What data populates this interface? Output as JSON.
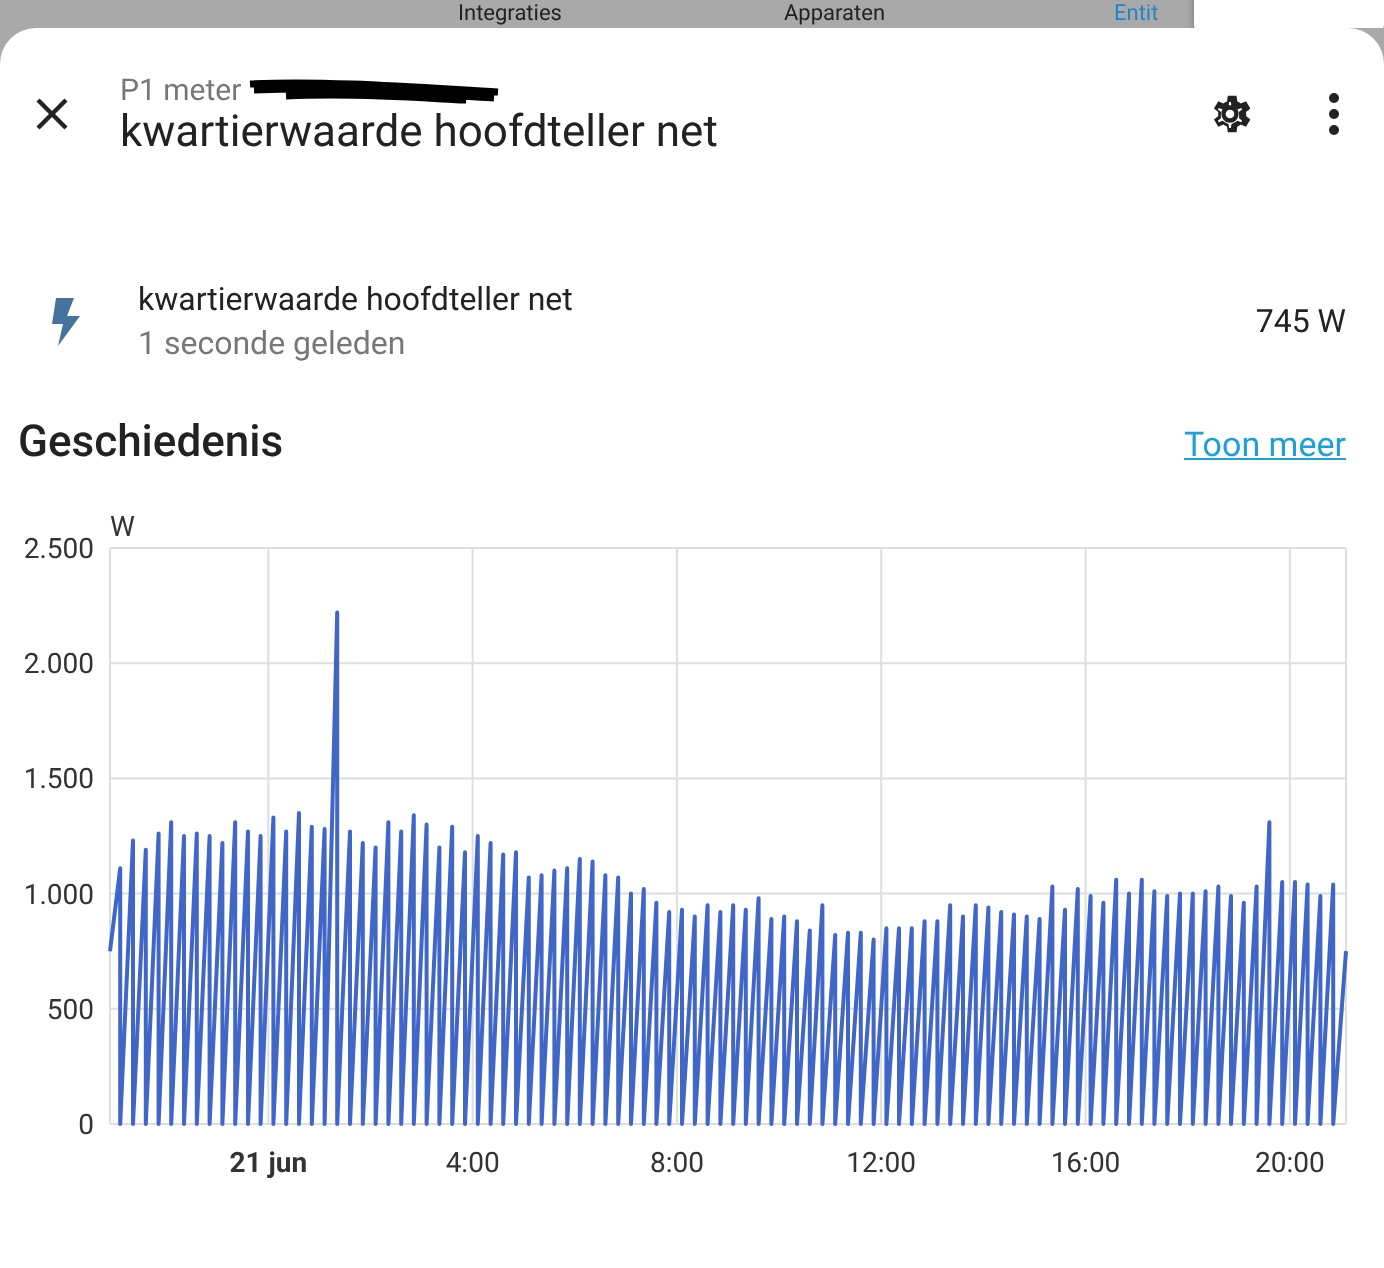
{
  "background_tabs": [
    {
      "label": "Integraties",
      "selected": false
    },
    {
      "label": "Apparaten",
      "selected": false
    },
    {
      "label": "Entit",
      "selected": true
    }
  ],
  "dialog": {
    "subtitle": "P1 meter",
    "title": "kwartierwaarde hoofdteller net"
  },
  "entity": {
    "name": "kwartierwaarde hoofdteller net",
    "last_changed": "1 seconde geleden",
    "state": "745 W"
  },
  "history": {
    "title": "Geschiedenis",
    "more_link": "Toon meer",
    "chart_data": {
      "type": "line",
      "ylabel": "W",
      "grid": true,
      "xlim": [
        -3.1,
        21.1
      ],
      "ylim": [
        0,
        2500
      ],
      "xticks": [
        {
          "value": 0,
          "label": "21 jun"
        },
        {
          "value": 4,
          "label": "4:00"
        },
        {
          "value": 8,
          "label": "8:00"
        },
        {
          "value": 12,
          "label": "12:00"
        },
        {
          "value": 16,
          "label": "16:00"
        },
        {
          "value": 20,
          "label": "20:00"
        }
      ],
      "yticks": [
        {
          "value": 0,
          "label": "0"
        },
        {
          "value": 500,
          "label": "500"
        },
        {
          "value": 1000,
          "label": "1.000"
        },
        {
          "value": 1500,
          "label": "1.500"
        },
        {
          "value": 2000,
          "label": "2.000"
        },
        {
          "value": 2500,
          "label": "2.500"
        }
      ],
      "x": [
        -3.1,
        -2.9,
        -2.9,
        -2.65,
        -2.65,
        -2.4,
        -2.4,
        -2.15,
        -2.15,
        -1.9,
        -1.9,
        -1.65,
        -1.65,
        -1.4,
        -1.4,
        -1.15,
        -1.15,
        -0.9,
        -0.9,
        -0.65,
        -0.65,
        -0.4,
        -0.4,
        -0.15,
        -0.15,
        0.1,
        0.1,
        0.35,
        0.35,
        0.6,
        0.6,
        0.85,
        0.85,
        1.1,
        1.1,
        1.35,
        1.35,
        1.6,
        1.6,
        1.85,
        1.85,
        2.1,
        2.1,
        2.35,
        2.35,
        2.6,
        2.6,
        2.85,
        2.85,
        3.1,
        3.1,
        3.35,
        3.35,
        3.6,
        3.6,
        3.85,
        3.85,
        4.1,
        4.1,
        4.35,
        4.35,
        4.6,
        4.6,
        4.85,
        4.85,
        5.1,
        5.1,
        5.35,
        5.35,
        5.6,
        5.6,
        5.85,
        5.85,
        6.1,
        6.1,
        6.35,
        6.35,
        6.6,
        6.6,
        6.85,
        6.85,
        7.1,
        7.1,
        7.35,
        7.35,
        7.6,
        7.6,
        7.85,
        7.85,
        8.1,
        8.1,
        8.35,
        8.35,
        8.6,
        8.6,
        8.85,
        8.85,
        9.1,
        9.1,
        9.35,
        9.35,
        9.6,
        9.6,
        9.85,
        9.85,
        10.1,
        10.1,
        10.35,
        10.35,
        10.6,
        10.6,
        10.85,
        10.85,
        11.1,
        11.1,
        11.35,
        11.35,
        11.6,
        11.6,
        11.85,
        11.85,
        12.1,
        12.1,
        12.35,
        12.35,
        12.6,
        12.6,
        12.85,
        12.85,
        13.1,
        13.1,
        13.35,
        13.35,
        13.6,
        13.6,
        13.85,
        13.85,
        14.1,
        14.1,
        14.35,
        14.35,
        14.6,
        14.6,
        14.85,
        14.85,
        15.1,
        15.1,
        15.35,
        15.35,
        15.6,
        15.6,
        15.85,
        15.85,
        16.1,
        16.1,
        16.35,
        16.35,
        16.6,
        16.6,
        16.85,
        16.85,
        17.1,
        17.1,
        17.35,
        17.35,
        17.6,
        17.6,
        17.85,
        17.85,
        18.1,
        18.1,
        18.35,
        18.35,
        18.6,
        18.6,
        18.85,
        18.85,
        19.1,
        19.1,
        19.35,
        19.35,
        19.6,
        19.6,
        19.85,
        19.85,
        20.1,
        20.1,
        20.35,
        20.35,
        20.6,
        20.6,
        20.85,
        20.85,
        21.1
      ],
      "series": [
        {
          "color": "#4066c8",
          "values": [
            750,
            1110,
            0,
            1230,
            0,
            1190,
            0,
            1260,
            0,
            1310,
            0,
            1250,
            0,
            1260,
            0,
            1250,
            0,
            1220,
            0,
            1310,
            0,
            1270,
            0,
            1250,
            0,
            1330,
            0,
            1270,
            0,
            1350,
            0,
            1290,
            0,
            1280,
            0,
            2220,
            0,
            1270,
            0,
            1220,
            0,
            1200,
            0,
            1310,
            0,
            1270,
            0,
            1340,
            0,
            1300,
            0,
            1200,
            0,
            1290,
            0,
            1180,
            0,
            1250,
            0,
            1220,
            0,
            1170,
            0,
            1180,
            0,
            1070,
            0,
            1080,
            0,
            1100,
            0,
            1110,
            0,
            1150,
            0,
            1140,
            0,
            1080,
            0,
            1070,
            0,
            1000,
            0,
            1020,
            0,
            960,
            0,
            920,
            0,
            930,
            0,
            900,
            0,
            950,
            0,
            920,
            0,
            950,
            0,
            930,
            0,
            980,
            0,
            890,
            0,
            900,
            0,
            880,
            0,
            840,
            0,
            950,
            0,
            820,
            0,
            830,
            0,
            830,
            0,
            800,
            0,
            850,
            0,
            850,
            0,
            850,
            0,
            880,
            0,
            880,
            0,
            950,
            0,
            900,
            0,
            950,
            0,
            940,
            0,
            920,
            0,
            910,
            0,
            900,
            0,
            890,
            0,
            1030,
            0,
            930,
            0,
            1020,
            0,
            990,
            0,
            960,
            0,
            1060,
            0,
            1000,
            0,
            1060,
            0,
            1010,
            0,
            990,
            0,
            1000,
            0,
            1000,
            0,
            1010,
            0,
            1030,
            0,
            990,
            0,
            960,
            0,
            1030,
            0,
            1310,
            0,
            1050,
            0,
            1050,
            0,
            1040,
            0,
            990,
            0,
            1040,
            0,
            750
          ]
        }
      ]
    }
  }
}
